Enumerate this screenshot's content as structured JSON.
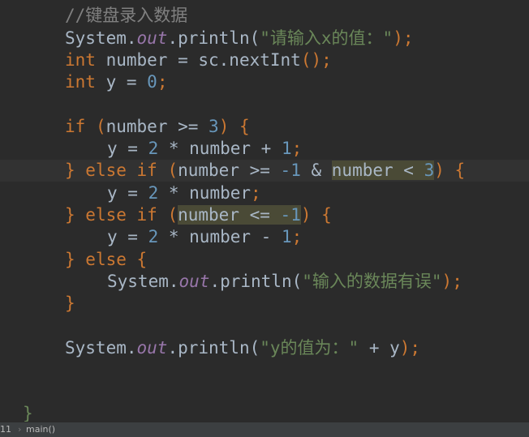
{
  "code": {
    "comment": "//键盘录入数据",
    "println_prompt": {
      "prefix": "System.",
      "field": "out",
      "method": ".println(",
      "str": "\"请输入x的值：\"",
      "suffix": ");"
    },
    "decl_number": {
      "kw": "int",
      "rest": " number = sc.nextInt",
      "parens": "()",
      "semi": ";"
    },
    "decl_y": {
      "kw": "int",
      "rest": " y = ",
      "num": "0",
      "semi": ";"
    },
    "if_line": {
      "kw": "if",
      "sp": " ",
      "open": "(",
      "cond": "number >= ",
      "num": "3",
      "close": ")",
      "brace": " {"
    },
    "assign1": {
      "pre": "y = ",
      "n1": "2",
      "mid": " * number + ",
      "n2": "1",
      "semi": ";"
    },
    "elseif1": {
      "brace_close": "}",
      "kw": " else if ",
      "open": "(",
      "cond1": "number >= ",
      "num1": "-1",
      "amp": " & ",
      "cond2": "number < ",
      "num2": "3",
      "close": ")",
      "brace": " {"
    },
    "assign2": {
      "pre": "y = ",
      "n1": "2",
      "mid": " * number",
      "semi": ";"
    },
    "elseif2": {
      "brace_close": "}",
      "kw": " else if ",
      "open": "(",
      "cond": "number <= ",
      "num": "-1",
      "close": ")",
      "brace": " {"
    },
    "assign3": {
      "pre": "y = ",
      "n1": "2",
      "mid": " * number - ",
      "n2": "1",
      "semi": ";"
    },
    "else_line": {
      "brace_close": "}",
      "kw": " else ",
      "brace": "{"
    },
    "println_error": {
      "prefix": "System.",
      "field": "out",
      "method": ".println(",
      "str": "\"输入的数据有误\"",
      "suffix": ");"
    },
    "close_brace": "}",
    "println_result": {
      "prefix": "System.",
      "field": "out",
      "method": ".println(",
      "str": "\"y的值为：\"",
      "rest": " + y",
      "suffix": ");"
    },
    "method_close": "}"
  },
  "statusbar": {
    "line_no": "11",
    "separator": "›",
    "crumb": "main()"
  },
  "colors": {
    "background": "#2b2b2b",
    "keyword": "#cc7832",
    "number": "#6897bb",
    "string": "#6a8759",
    "field": "#9876aa",
    "comment": "#808080",
    "text": "#a9b7c6"
  }
}
